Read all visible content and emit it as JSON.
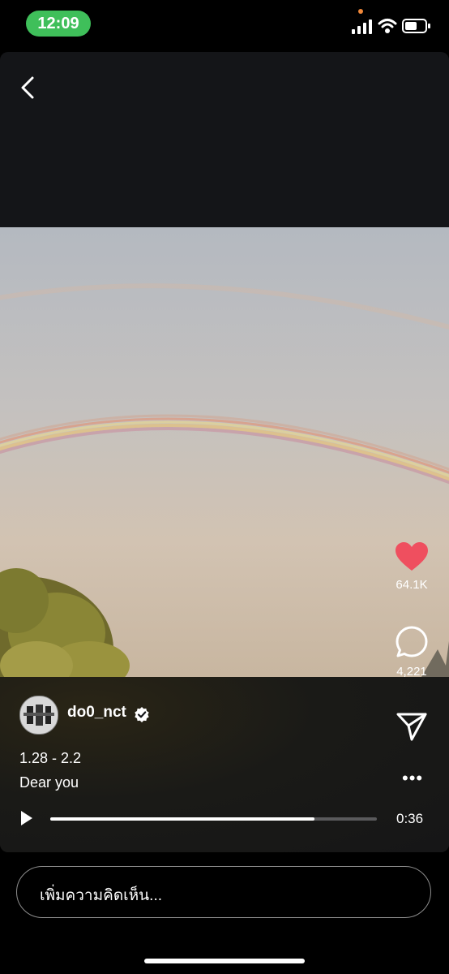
{
  "status_bar": {
    "time": "12:09",
    "icons": [
      "orange-dot-indicator",
      "signal-icon",
      "wifi-icon",
      "battery-icon"
    ]
  },
  "header": {
    "back_icon": "chevron-left-icon"
  },
  "actions": {
    "like_count": "64.1K",
    "comment_count": "4,221",
    "like_color": "#ef4f5f"
  },
  "post": {
    "username": "do0_nct",
    "caption_line1": "1.28 - 2.2",
    "caption_line2": "Dear you",
    "more": "•••"
  },
  "player": {
    "duration": "0:36",
    "progress": 0.81
  },
  "comment": {
    "placeholder": "เพิ่มความคิดเห็น..."
  }
}
